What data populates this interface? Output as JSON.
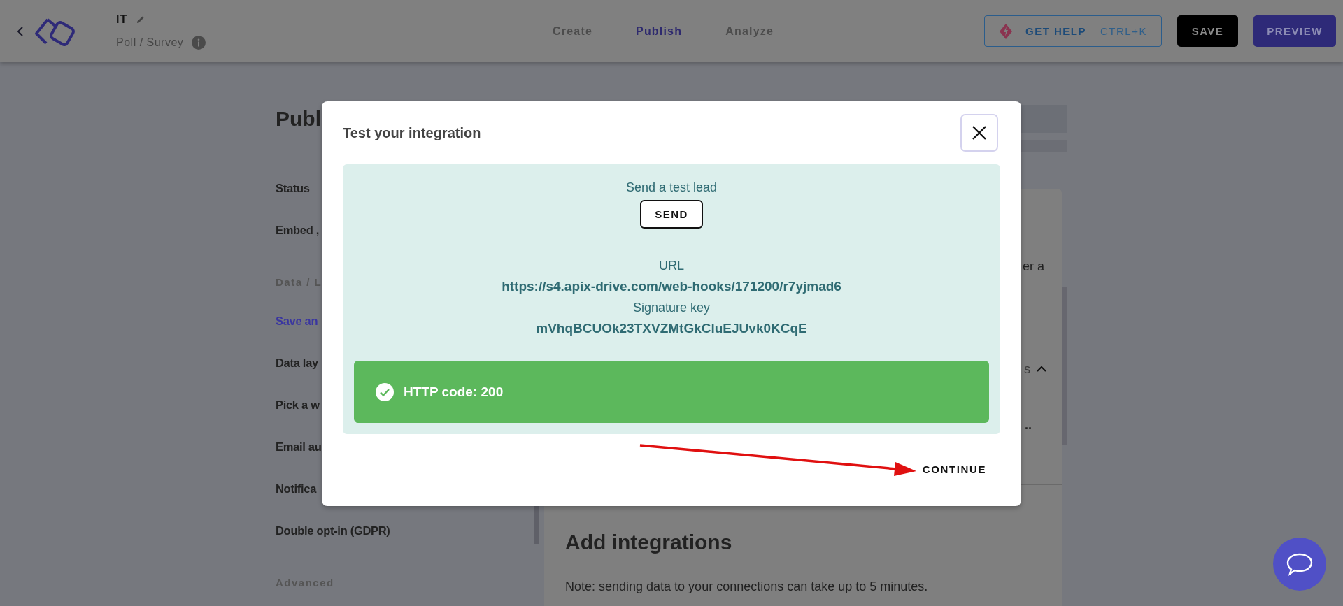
{
  "header": {
    "title": "IT",
    "subtitle": "Poll / Survey"
  },
  "tabs": [
    {
      "label": "Create",
      "selected": false
    },
    {
      "label": "Publish",
      "selected": true
    },
    {
      "label": "Analyze",
      "selected": false
    }
  ],
  "actions": {
    "help": "GET HELP",
    "help_shortcut": "CTRL+K",
    "save": "SAVE",
    "preview": "PREVIEW"
  },
  "sidebar": {
    "heading": "Publ",
    "items": [
      {
        "label": "Status",
        "kind": "item",
        "selected": false
      },
      {
        "label": "Embed ,",
        "kind": "item",
        "selected": false
      },
      {
        "label": "Data / L",
        "kind": "section"
      },
      {
        "label": "Save an",
        "kind": "item",
        "selected": true
      },
      {
        "label": "Data lay",
        "kind": "item",
        "selected": false
      },
      {
        "label": "Pick a w",
        "kind": "item",
        "selected": false
      },
      {
        "label": "Email au",
        "kind": "item",
        "selected": false
      },
      {
        "label": "Notifica",
        "kind": "item",
        "selected": false
      },
      {
        "label": "Double opt-in (GDPR)",
        "kind": "item",
        "selected": false
      },
      {
        "label": "Advanced",
        "kind": "section"
      }
    ]
  },
  "panel": {
    "text_1": "er a",
    "text_2": "s",
    "text_3": "..",
    "heading": "Add integrations",
    "note": "Note: sending data to your connections can take up to 5 minutes."
  },
  "modal": {
    "title": "Test your integration",
    "send_label": "Send a test lead",
    "send_button": "SEND",
    "url_label": "URL",
    "url": "https://s4.apix-drive.com/web-hooks/171200/r7yjmad6",
    "key_label": "Signature key",
    "key": "mVhqBCUOk23TXVZMtGkCluEJUvk0KCqE",
    "result": {
      "text": "HTTP code: 200",
      "success": true
    },
    "continue": "CONTINUE"
  }
}
